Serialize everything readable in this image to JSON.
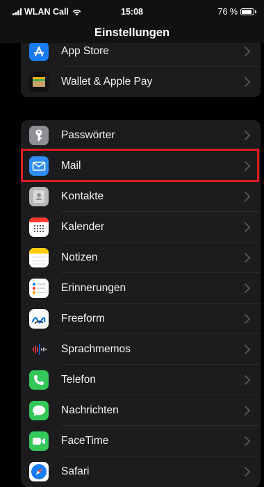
{
  "status_bar": {
    "carrier": "WLAN Call",
    "time": "15:08",
    "battery": "76 %",
    "battery_level": 0.76
  },
  "nav": {
    "title": "Einstellungen"
  },
  "group1": [
    {
      "label": "App Store",
      "icon": "app-store-icon",
      "color": "#1a7cf5"
    },
    {
      "label": "Wallet & Apple Pay",
      "icon": "wallet-icon",
      "color": "#000000"
    }
  ],
  "group2": [
    {
      "label": "Passwörter",
      "icon": "key-icon",
      "color": "#8e8e93"
    },
    {
      "label": "Mail",
      "icon": "mail-icon",
      "color": "#2f8df5"
    },
    {
      "label": "Kontakte",
      "icon": "contacts-icon",
      "color": "#b7b7b7"
    },
    {
      "label": "Kalender",
      "icon": "calendar-icon",
      "color": "#ffffff"
    },
    {
      "label": "Notizen",
      "icon": "notes-icon",
      "color": "#ffffff"
    },
    {
      "label": "Erinnerungen",
      "icon": "reminders-icon",
      "color": "#ffffff"
    },
    {
      "label": "Freeform",
      "icon": "freeform-icon",
      "color": "#ffffff"
    },
    {
      "label": "Sprachmemos",
      "icon": "voice-memos-icon",
      "color": "#1c1c1e"
    },
    {
      "label": "Telefon",
      "icon": "phone-icon",
      "color": "#34c759"
    },
    {
      "label": "Nachrichten",
      "icon": "messages-icon",
      "color": "#34c759"
    },
    {
      "label": "FaceTime",
      "icon": "facetime-icon",
      "color": "#34c759"
    },
    {
      "label": "Safari",
      "icon": "safari-icon",
      "color": "#1a7cf5"
    }
  ]
}
